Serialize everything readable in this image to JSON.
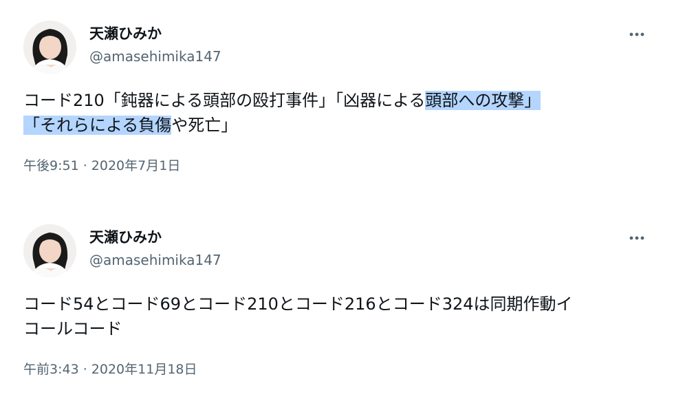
{
  "tweets": [
    {
      "display_name": "天瀬ひみか",
      "handle": "@amasehimika147",
      "text_line1_plain": "コード210「鈍器による頭部の殴打事件」「凶器による",
      "text_line1_highlight": "頭部への攻撃」",
      "text_line2_highlight": "「それらによる負傷",
      "text_line2_plain": "や死亡」",
      "timestamp": "午後9:51 · 2020年7月1日"
    },
    {
      "display_name": "天瀬ひみか",
      "handle": "@amasehimika147",
      "text_line1": "コード54とコード69とコード210とコード216とコード324は同期作動イ",
      "text_line2": "コールコード",
      "timestamp": "午前3:43 · 2020年11月18日"
    }
  ],
  "icons": {
    "more": "more-horizontal-icon",
    "avatar": "avatar-image"
  },
  "colors": {
    "text": "#0f1419",
    "secondary": "#536471",
    "selection": "#b4d5fe"
  }
}
